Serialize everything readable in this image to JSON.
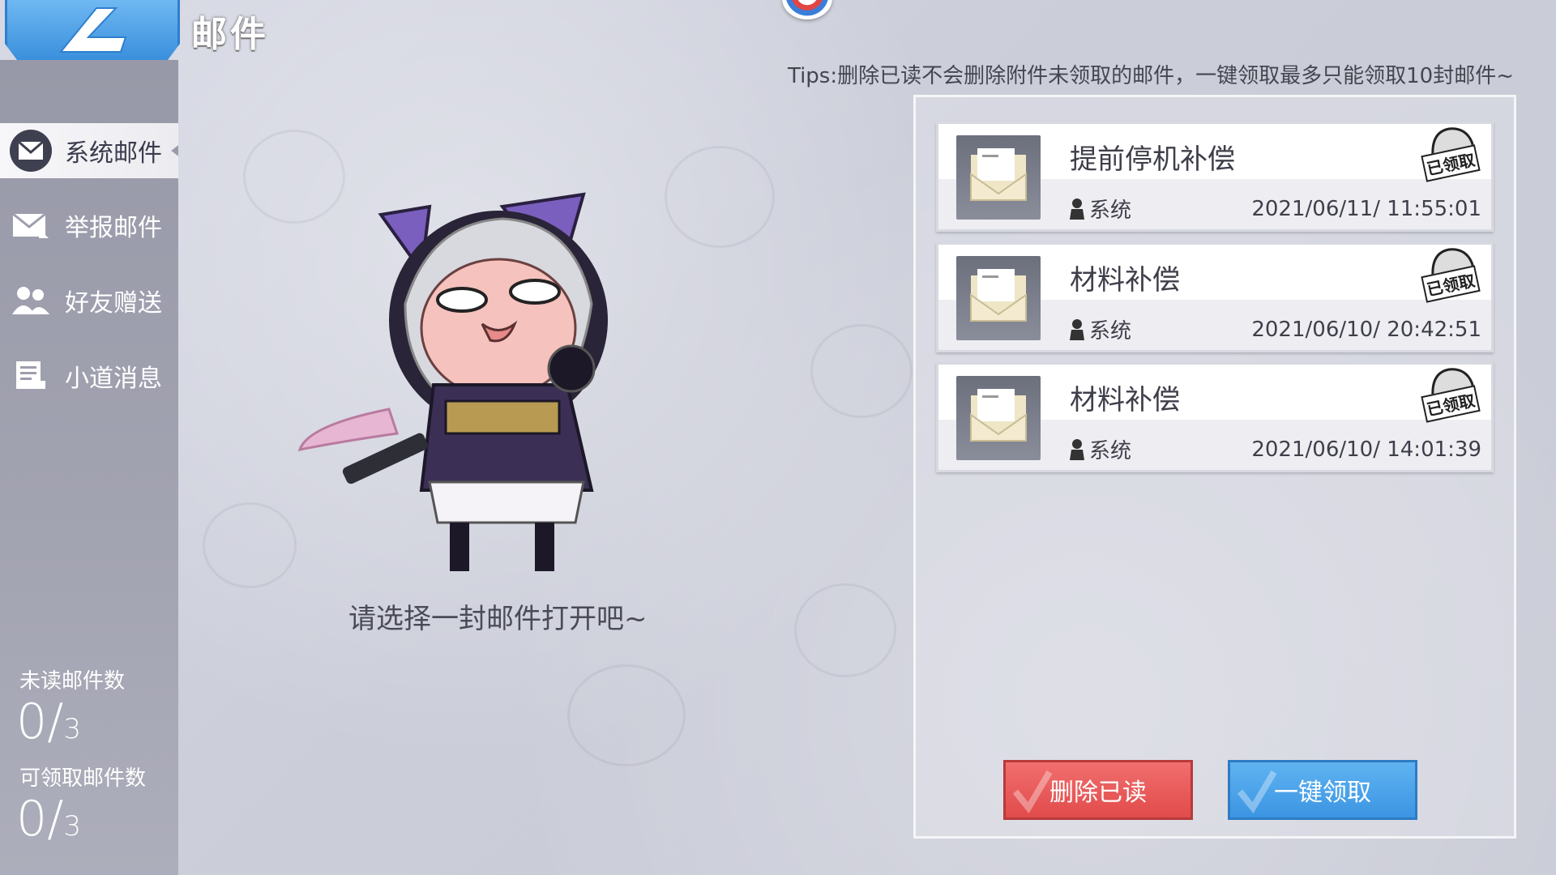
{
  "header": {
    "title": "邮件",
    "back_icon": "back-arrow-icon"
  },
  "sidebar": {
    "items": [
      {
        "label": "系统邮件",
        "icon": "system-mail-icon",
        "active": true
      },
      {
        "label": "举报邮件",
        "icon": "report-mail-icon",
        "active": false
      },
      {
        "label": "好友赠送",
        "icon": "friends-icon",
        "active": false
      },
      {
        "label": "小道消息",
        "icon": "news-icon",
        "active": false
      }
    ],
    "stats": {
      "unread_label": "未读邮件数",
      "unread_count": "0/",
      "unread_total": "3",
      "claimable_label": "可领取邮件数",
      "claimable_count": "0/",
      "claimable_total": "3"
    }
  },
  "tips": "Tips:删除已读不会删除附件未领取的邮件，一键领取最多只能领取10封邮件~",
  "hint": "请选择一封邮件打开吧~",
  "mails": [
    {
      "title": "提前停机补偿",
      "sender": "系统",
      "date": "2021/06/11/ 11:55:01",
      "status": "已领取"
    },
    {
      "title": "材料补偿",
      "sender": "系统",
      "date": "2021/06/10/ 20:42:51",
      "status": "已领取"
    },
    {
      "title": "材料补偿",
      "sender": "系统",
      "date": "2021/06/10/ 14:01:39",
      "status": "已领取"
    }
  ],
  "actions": {
    "delete_read": "删除已读",
    "claim_all": "一键领取"
  },
  "colors": {
    "delete_button": "#e85a5a",
    "claim_button": "#4aa3ea",
    "back_button": "#4a9fe6",
    "sidebar_bg": "#9d9eac"
  }
}
